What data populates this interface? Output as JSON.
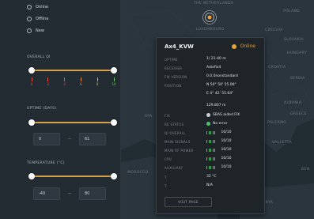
{
  "filters": {
    "status_options": [
      {
        "label": "Online",
        "selected": false
      },
      {
        "label": "Offline",
        "selected": false
      },
      {
        "label": "New",
        "selected": false
      }
    ],
    "overall_qi": {
      "label": "OVERALL QI",
      "range": [
        0,
        10
      ],
      "ticks": [
        {
          "label": "0",
          "color": "#e0524a"
        },
        {
          "label": "2",
          "color": "#e0524a"
        },
        {
          "label": "4",
          "color": "#e0524a"
        },
        {
          "label": "6",
          "color": "#e08a3e"
        },
        {
          "label": "8",
          "color": "#e0b34a"
        },
        {
          "label": "10",
          "color": "#6fc26a"
        }
      ]
    },
    "uptime": {
      "label": "UPTIME (DAYS)",
      "min": "0",
      "separator": "—",
      "max": "61"
    },
    "temperature": {
      "label": "TEMPERATURE (°C)",
      "min": "-40",
      "separator": "—",
      "max": "80"
    }
  },
  "map": {
    "places": [
      "THE NETHERLANDS",
      "POLAND",
      "LUXEMBOURG",
      "CZECHIA",
      "SLOVAKIA",
      "HUNGARY",
      "CROATIA",
      "SERBIA",
      "ALBANIA",
      "GREECE",
      "PALERMO",
      "VALLETTA",
      "SPA",
      "MOROCCO",
      "LIBYA",
      "BEN"
    ],
    "marker": "signal-tower-icon"
  },
  "popup": {
    "title": "Ax4_KVW",
    "status": "Online",
    "status_color": "#e6a339",
    "rows": [
      {
        "key": "UPTIME",
        "value": "1/ 21-40 m"
      },
      {
        "key": "RECEIVER",
        "value": "Astefix4"
      },
      {
        "key": "FW VERSION",
        "value": "0.0.0nonstandard"
      },
      {
        "key": "POSITION",
        "value": "N 50° 50' 55.06\""
      },
      {
        "key": "",
        "value": "E 4° 42' 55.64\""
      },
      {
        "key": "",
        "value": "129.807 m"
      },
      {
        "key": "FIX",
        "value": "SBAS aided FIX",
        "icon": "satellite-icon"
      },
      {
        "key": "RE STATUS",
        "value": "No error",
        "icon": "check-circle-icon"
      },
      {
        "key": "QI OVERALL",
        "value": "10/10",
        "bars": true
      },
      {
        "key": "MAIN SIGNALS",
        "value": "10/10",
        "bars": true
      },
      {
        "key": "MAIN RF POWER",
        "value": "10/10",
        "bars": true
      },
      {
        "key": "CPU",
        "value": "10/10",
        "bars": true
      },
      {
        "key": "AUXILIARY",
        "value": "10/10",
        "bars": true
      },
      {
        "key": "T",
        "value": "32 °C"
      },
      {
        "key": "T",
        "value": "N/A"
      }
    ],
    "visit_button": "VISIT PAGE"
  }
}
